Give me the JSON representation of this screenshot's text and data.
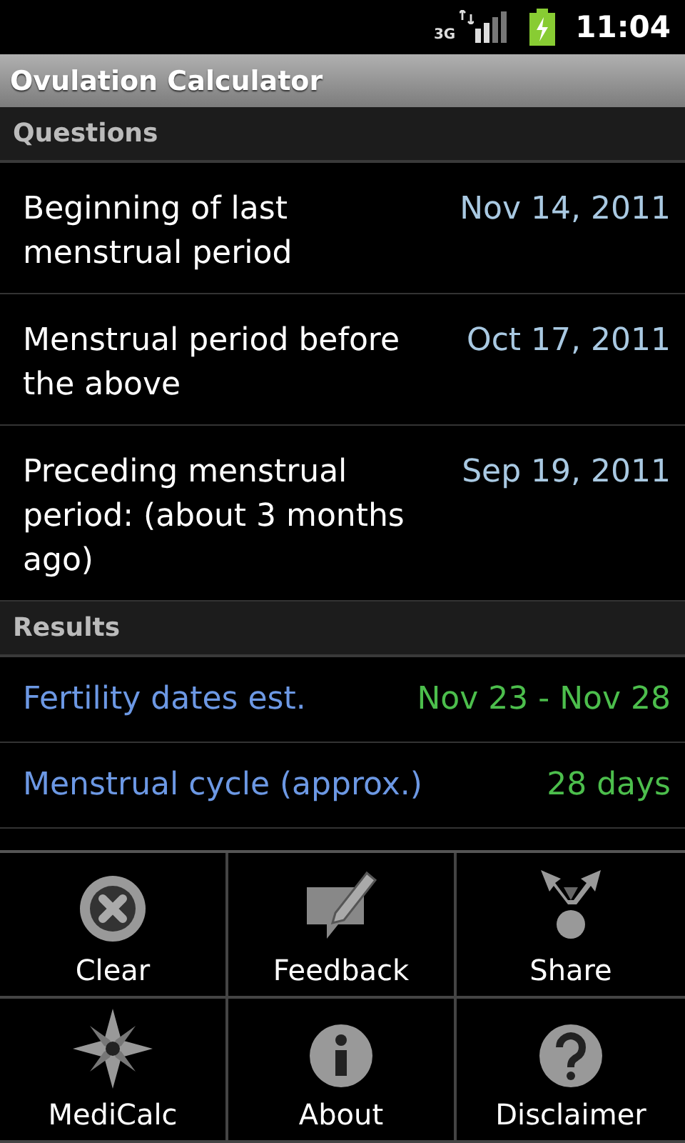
{
  "status_bar": {
    "network": "3G",
    "time": "11:04"
  },
  "title": "Ovulation Calculator",
  "sections": [
    {
      "header": "Questions",
      "kind": "question",
      "rows": [
        {
          "label": "Beginning of last menstrual period",
          "value": "Nov 14, 2011"
        },
        {
          "label": "Menstrual period before the above",
          "value": "Oct 17, 2011"
        },
        {
          "label": "Preceding menstrual period: (about 3 months ago)",
          "value": "Sep 19, 2011"
        }
      ]
    },
    {
      "header": "Results",
      "kind": "result",
      "rows": [
        {
          "label": "Fertility dates est.",
          "value": "Nov 23 - Nov 28"
        },
        {
          "label": "Menstrual cycle (approx.)",
          "value": "28 days"
        }
      ]
    }
  ],
  "menu": [
    {
      "label": "Clear",
      "kind": "clear"
    },
    {
      "label": "Feedback",
      "kind": "feedback"
    },
    {
      "label": "Share",
      "kind": "share"
    },
    {
      "label": "MediCalc",
      "kind": "compass"
    },
    {
      "label": "About",
      "kind": "info"
    },
    {
      "label": "Disclaimer",
      "kind": "help"
    }
  ]
}
